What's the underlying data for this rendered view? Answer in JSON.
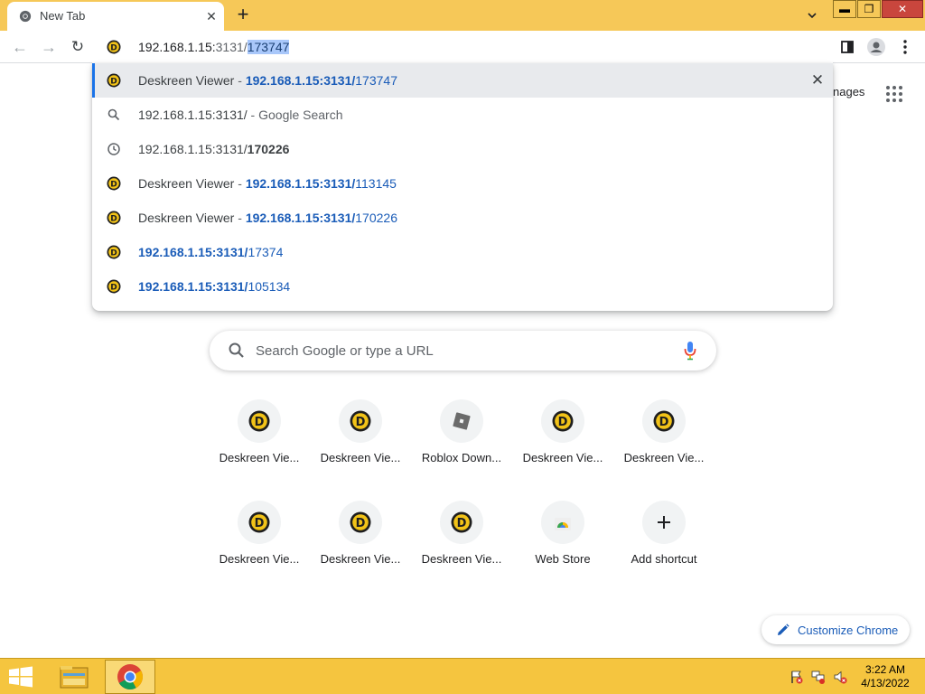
{
  "browser": {
    "tab_title": "New Tab",
    "omnibox": {
      "text_dim": "192.168.1.15:",
      "text_port": "3131/",
      "text_selected": "173747"
    }
  },
  "suggestions": [
    {
      "type": "site",
      "title": "Deskreen Viewer",
      "sep": " - ",
      "url_bold": "192.168.1.15:3131/",
      "url_rest": "173747",
      "selected": true
    },
    {
      "type": "search",
      "text": "192.168.1.15:3131/",
      "suffix": " - Google Search"
    },
    {
      "type": "history",
      "text": "192.168.1.15:3131/",
      "bold": "170226"
    },
    {
      "type": "site",
      "title": "Deskreen Viewer",
      "sep": " - ",
      "url_bold": "192.168.1.15:3131/",
      "url_rest": "113145"
    },
    {
      "type": "site",
      "title": "Deskreen Viewer",
      "sep": " - ",
      "url_bold": "192.168.1.15:3131/",
      "url_rest": "170226"
    },
    {
      "type": "site",
      "url_bold": "192.168.1.15:3131/",
      "url_rest": "17374"
    },
    {
      "type": "site",
      "url_bold": "192.168.1.15:3131/",
      "url_rest": "105134"
    }
  ],
  "page": {
    "images_link": "nages",
    "search_placeholder": "Search Google or type a URL",
    "customize_label": "Customize Chrome",
    "shortcuts": [
      {
        "label": "Deskreen Vie...",
        "icon": "deskreen-icon"
      },
      {
        "label": "Deskreen Vie...",
        "icon": "deskreen-icon"
      },
      {
        "label": "Roblox Down...",
        "icon": "roblox-icon"
      },
      {
        "label": "Deskreen Vie...",
        "icon": "deskreen-icon"
      },
      {
        "label": "Deskreen Vie...",
        "icon": "deskreen-icon"
      },
      {
        "label": "Deskreen Vie...",
        "icon": "deskreen-icon"
      },
      {
        "label": "Deskreen Vie...",
        "icon": "deskreen-icon"
      },
      {
        "label": "Deskreen Vie...",
        "icon": "deskreen-icon"
      },
      {
        "label": "Web Store",
        "icon": "web-store-icon"
      },
      {
        "label": "Add shortcut",
        "icon": "plus-icon"
      }
    ]
  },
  "taskbar": {
    "time": "3:22 AM",
    "date": "4/13/2022"
  },
  "colors": {
    "accent": "#1a73e8",
    "titlebar": "#f6c858",
    "taskbar": "#f5c53f",
    "link": "#1a5cb8"
  }
}
